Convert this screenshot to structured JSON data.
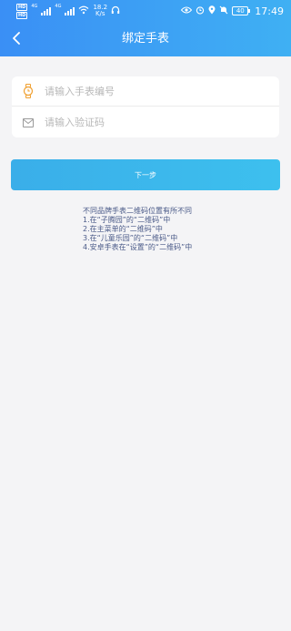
{
  "status_bar": {
    "sim1": "HD",
    "sim2": "HD",
    "net1": "4G",
    "net2": "4G",
    "speed_value": "18.2",
    "speed_unit": "K/s",
    "battery": "40",
    "time": "17:49",
    "icons": [
      "headphones-icon",
      "eye-icon",
      "alarm-icon",
      "location-icon",
      "mute-icon"
    ]
  },
  "header": {
    "title": "绑定手表",
    "back_icon": "chevron-left-icon"
  },
  "form": {
    "watch_number": {
      "value": "",
      "placeholder": "请输入手表编号",
      "icon": "watch-icon"
    },
    "verify_code": {
      "value": "",
      "placeholder": "请输入验证码",
      "icon": "envelope-icon"
    }
  },
  "next_button": {
    "label": "下一步"
  },
  "tips": {
    "lines": [
      "不同品牌手表二维码位置有所不同",
      "1.在“子腾园”的“二维码”中",
      "2.在主菜单的“二维码”中",
      "3.在“儿童乐园”的“二维码”中",
      "4.安卓手表在“设置”的“二维码”中"
    ]
  },
  "colors": {
    "header_start": "#3a8ff5",
    "header_end": "#3fb0f3",
    "button": "#3cb6ec",
    "background": "#f4f4f6",
    "tips_text": "#4a5a88",
    "watch_icon": "#f0a030"
  }
}
